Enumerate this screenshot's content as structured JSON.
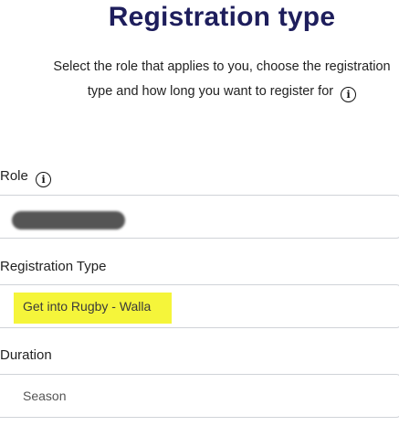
{
  "header": {
    "title": "Registration type",
    "subtitle_main": "Select the role that applies to you, choose the registration type and how long you want to register for"
  },
  "fields": {
    "role": {
      "label": "Role",
      "value_redacted": true
    },
    "registration_type": {
      "label": "Registration Type",
      "value": "Get into Rugby - Walla",
      "highlight_color": "#f5f53a"
    },
    "duration": {
      "label": "Duration",
      "value": "Season"
    }
  },
  "icons": {
    "info": "i"
  },
  "colors": {
    "title": "#1e1e5c",
    "border": "#d0d3d8"
  }
}
